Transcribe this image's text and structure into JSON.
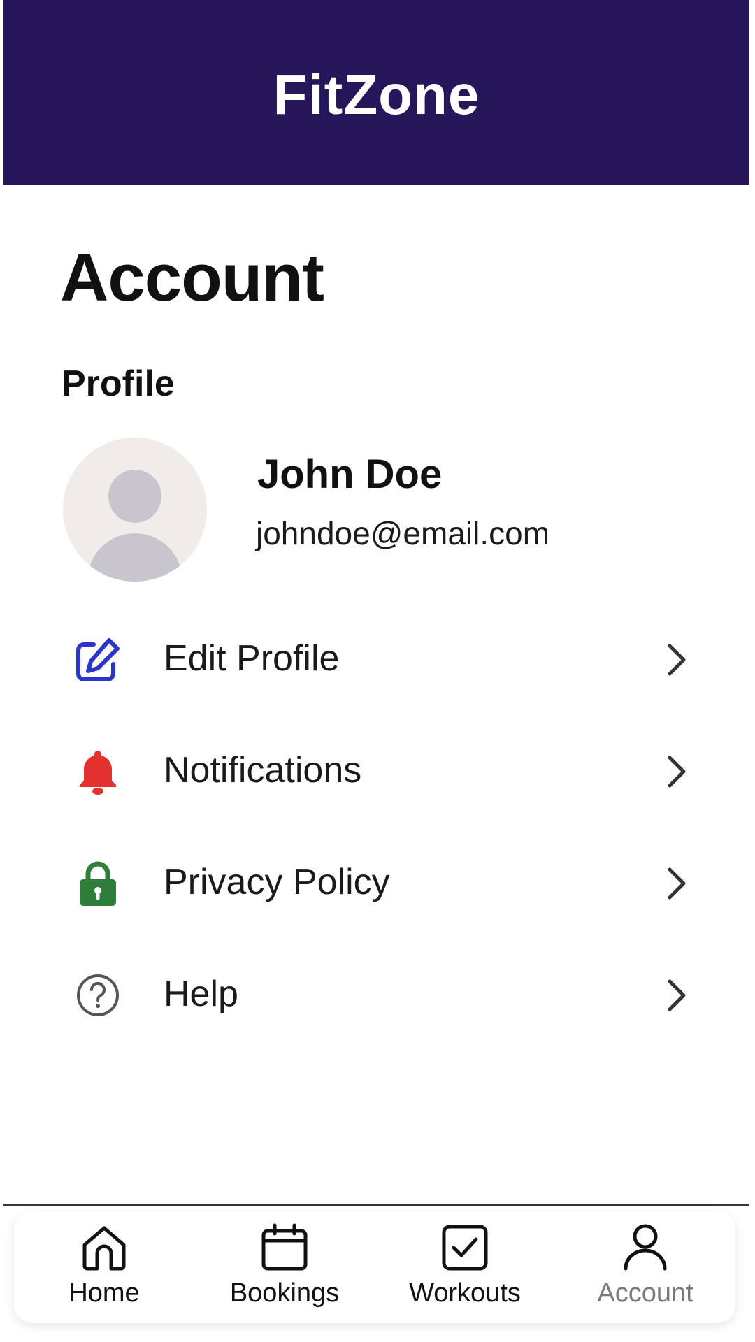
{
  "app": {
    "title": "FitZone",
    "header_color": "#26165a"
  },
  "page": {
    "title": "Account",
    "section_title": "Profile"
  },
  "profile": {
    "name": "John Doe",
    "email": "johndoe@email.com",
    "avatar_icon": "person-placeholder-icon"
  },
  "menu": {
    "items": [
      {
        "label": "Edit Profile",
        "icon": "edit-icon",
        "color": "#2b36c8"
      },
      {
        "label": "Notifications",
        "icon": "bell-icon",
        "color": "#e53030"
      },
      {
        "label": "Privacy Policy",
        "icon": "lock-icon",
        "color": "#2f7d3b"
      },
      {
        "label": "Help",
        "icon": "help-icon",
        "color": "#555555"
      }
    ]
  },
  "bottom_nav": {
    "active": "Account",
    "items": [
      {
        "label": "Home",
        "icon": "home-icon"
      },
      {
        "label": "Bookings",
        "icon": "calendar-icon"
      },
      {
        "label": "Workouts",
        "icon": "checkbox-icon"
      },
      {
        "label": "Account",
        "icon": "person-icon"
      }
    ]
  }
}
